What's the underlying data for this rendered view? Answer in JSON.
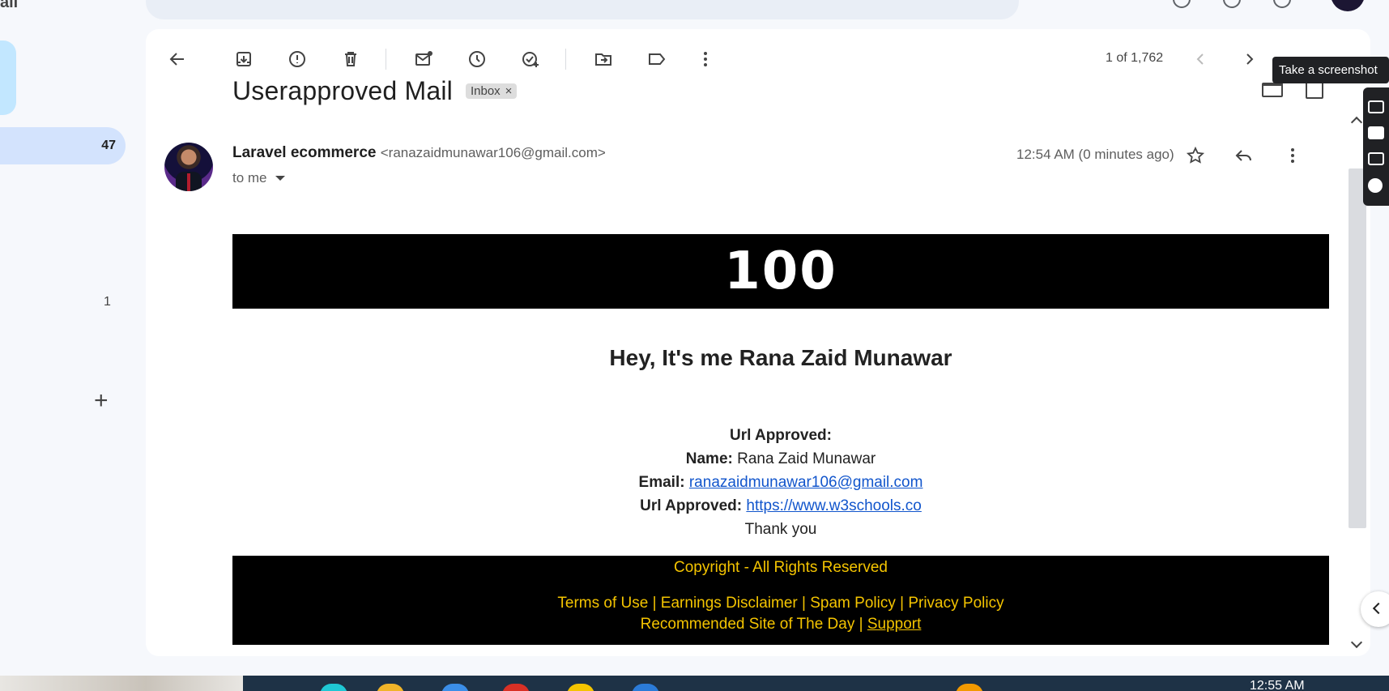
{
  "app": {
    "brand": "ail"
  },
  "nav": {
    "inbox_count": "47",
    "secondary_count": "1",
    "add_label": "+"
  },
  "toolbar": {
    "pagination": "1 of 1,762",
    "tooltip": "Take a screenshot"
  },
  "message": {
    "subject": "Userapproved Mail",
    "label": "Inbox",
    "label_remove": "×",
    "sender_name": "Laravel ecommerce",
    "sender_email": "<ranazaidmunawar106@gmail.com>",
    "recipient": "to me",
    "time": "12:54 AM (0 minutes ago)"
  },
  "email_body": {
    "banner": "100",
    "greeting": "Hey, It's me Rana Zaid Munawar",
    "heading": "Url Approved:",
    "name_label": "Name:",
    "name_value": "Rana Zaid Munawar",
    "email_label": "Email:",
    "email_value": "ranazaidmunawar106@gmail.com",
    "url_label": "Url Approved:",
    "url_value": "https://www.w3schools.co",
    "thanks": "Thank you"
  },
  "footer": {
    "copyright": "Copyright - All Rights Reserved",
    "links": "Terms of Use | Earnings Disclaimer | Spam Policy | Privacy Policy",
    "recommended": "Recommended Site of The Day | ",
    "support": "Support"
  },
  "taskbar": {
    "clock": "12:55 AM"
  },
  "colors": {
    "accent": "#0b57d0",
    "footer_text": "#f4c400",
    "link": "#1155cc"
  }
}
